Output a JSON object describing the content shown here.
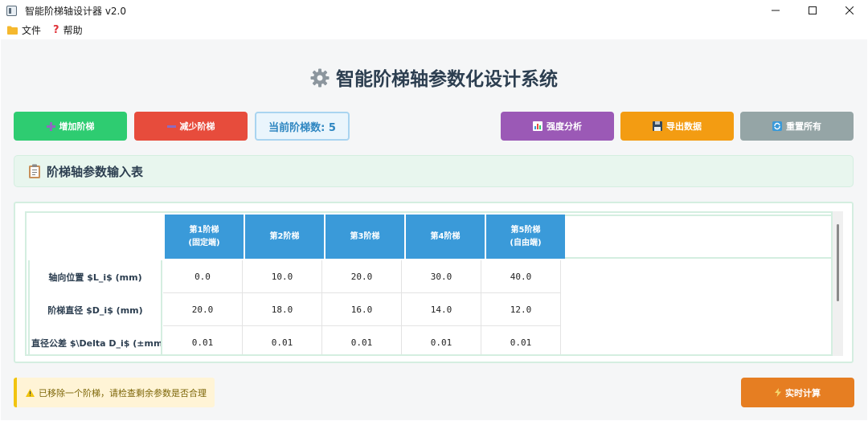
{
  "window": {
    "title": "智能阶梯轴设计器 v2.0"
  },
  "menu": [
    {
      "label": "文件",
      "icon": "folder-icon"
    },
    {
      "label": "帮助",
      "icon": "question-icon"
    }
  ],
  "page": {
    "title": "智能阶梯轴参数化设计系统",
    "icon": "gear-icon"
  },
  "toolbar": {
    "add_label": "增加阶梯",
    "remove_label": "减少阶梯",
    "count_label": "当前阶梯数: 5",
    "analysis_label": "强度分析",
    "export_label": "导出数据",
    "reset_label": "重置所有"
  },
  "section": {
    "title": "阶梯轴参数输入表",
    "icon": "clipboard-icon"
  },
  "table": {
    "columns": [
      {
        "line1": "第1阶梯",
        "line2": "(固定端)"
      },
      {
        "line1": "第2阶梯",
        "line2": ""
      },
      {
        "line1": "第3阶梯",
        "line2": ""
      },
      {
        "line1": "第4阶梯",
        "line2": ""
      },
      {
        "line1": "第5阶梯",
        "line2": "(自由端)"
      }
    ],
    "rows": [
      {
        "label": "轴向位置 $L_i$ (mm)",
        "values": [
          "0.0",
          "10.0",
          "20.0",
          "30.0",
          "40.0"
        ]
      },
      {
        "label": "阶梯直径 $D_i$ (mm)",
        "values": [
          "20.0",
          "18.0",
          "16.0",
          "14.0",
          "12.0"
        ]
      },
      {
        "label": "直径公差 $\\Delta D_i$ (±mm)",
        "values": [
          "0.01",
          "0.01",
          "0.01",
          "0.01",
          "0.01"
        ]
      }
    ]
  },
  "status": {
    "message": "已移除一个阶梯，请检查剩余参数是否合理"
  },
  "actions": {
    "calc_label": "实时计算"
  },
  "colors": {
    "add": "#2ecc71",
    "remove": "#e74c3c",
    "analysis": "#9b59b6",
    "export": "#f39c12",
    "reset": "#95a5a6",
    "calc": "#e67e22",
    "header": "#3a9ad9"
  }
}
